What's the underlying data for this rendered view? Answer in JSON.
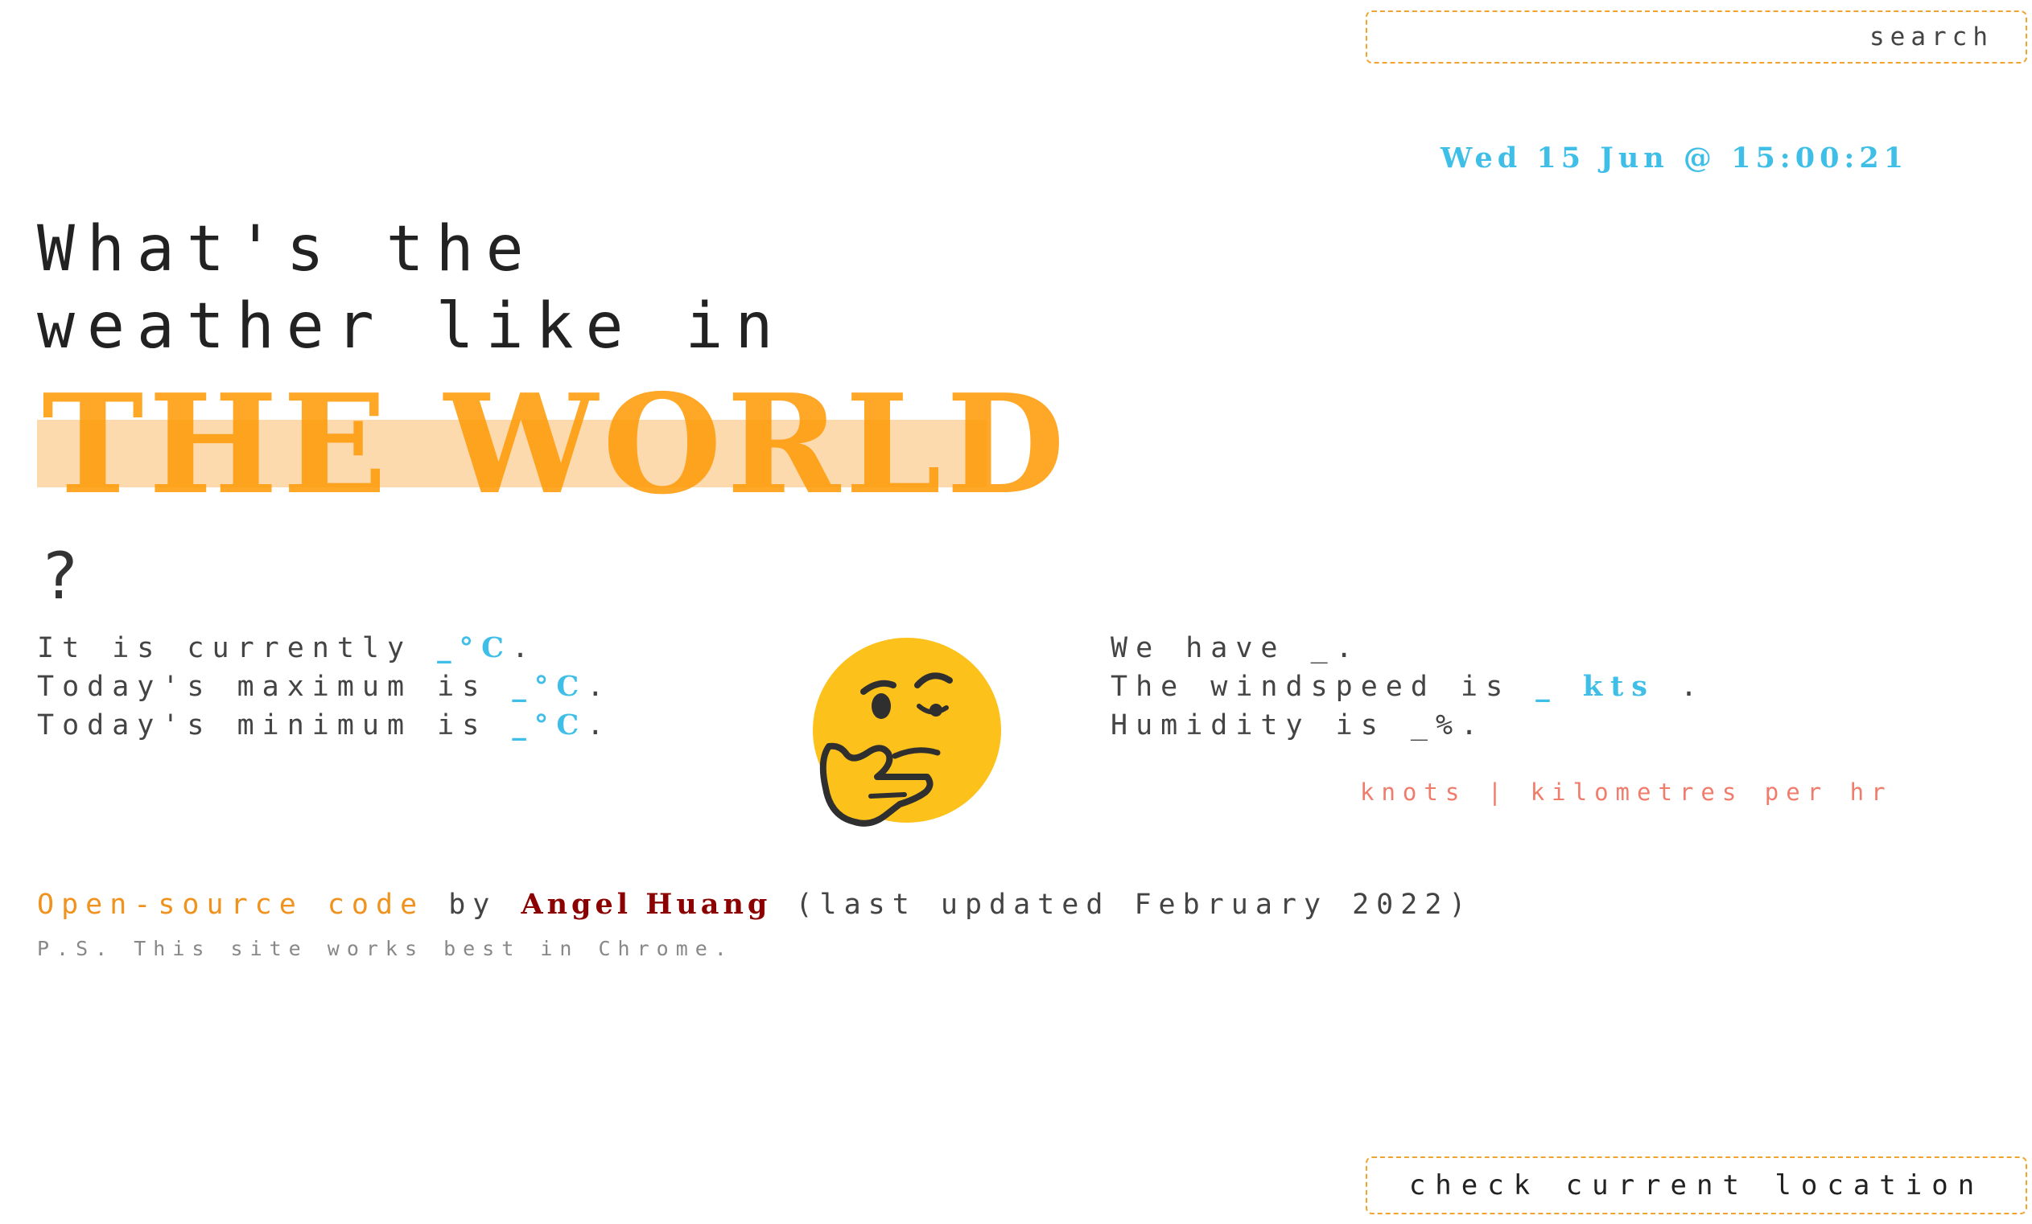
{
  "search": {
    "placeholder": "search"
  },
  "datetime": "Wed 15 Jun @ 15:00:21",
  "headline": {
    "line1": "What's the",
    "line2": "weather like in",
    "place": "THE WORLD",
    "question": "?"
  },
  "stats_left": {
    "current_prefix": "It is currently ",
    "current_value": "_",
    "current_unit": "°C",
    "current_suffix": ".",
    "max_prefix": "Today's maximum is ",
    "max_value": "_",
    "max_unit": "°C",
    "max_suffix": ".",
    "min_prefix": "Today's minimum is ",
    "min_value": "_",
    "min_unit": "°C",
    "min_suffix": "."
  },
  "stats_right": {
    "conditions_prefix": "We have ",
    "conditions_value": "_",
    "conditions_suffix": ".",
    "wind_prefix": "The windspeed is ",
    "wind_value": "_",
    "wind_unit": "kts",
    "wind_suffix": ".",
    "humidity_prefix": "Humidity is ",
    "humidity_value": "_",
    "humidity_suffix": "%."
  },
  "units": {
    "knots": "knots",
    "separator": "|",
    "kmh": "kilometres per hr"
  },
  "credits": {
    "code": "Open-source code",
    "by": " by ",
    "author": "Angel Huang",
    "updated": " (last updated February 2022)"
  },
  "ps": "P.S. This site works best in Chrome.",
  "location_button": "check current location",
  "emoji": {
    "icon": "thinking-face-icon"
  },
  "colors": {
    "accent": "#3fbfe8",
    "orange": "#ff9c0a",
    "highlight": "#fdd9ae",
    "author": "#8b0000",
    "units": "#f07c6c",
    "border": "#f0a430"
  }
}
